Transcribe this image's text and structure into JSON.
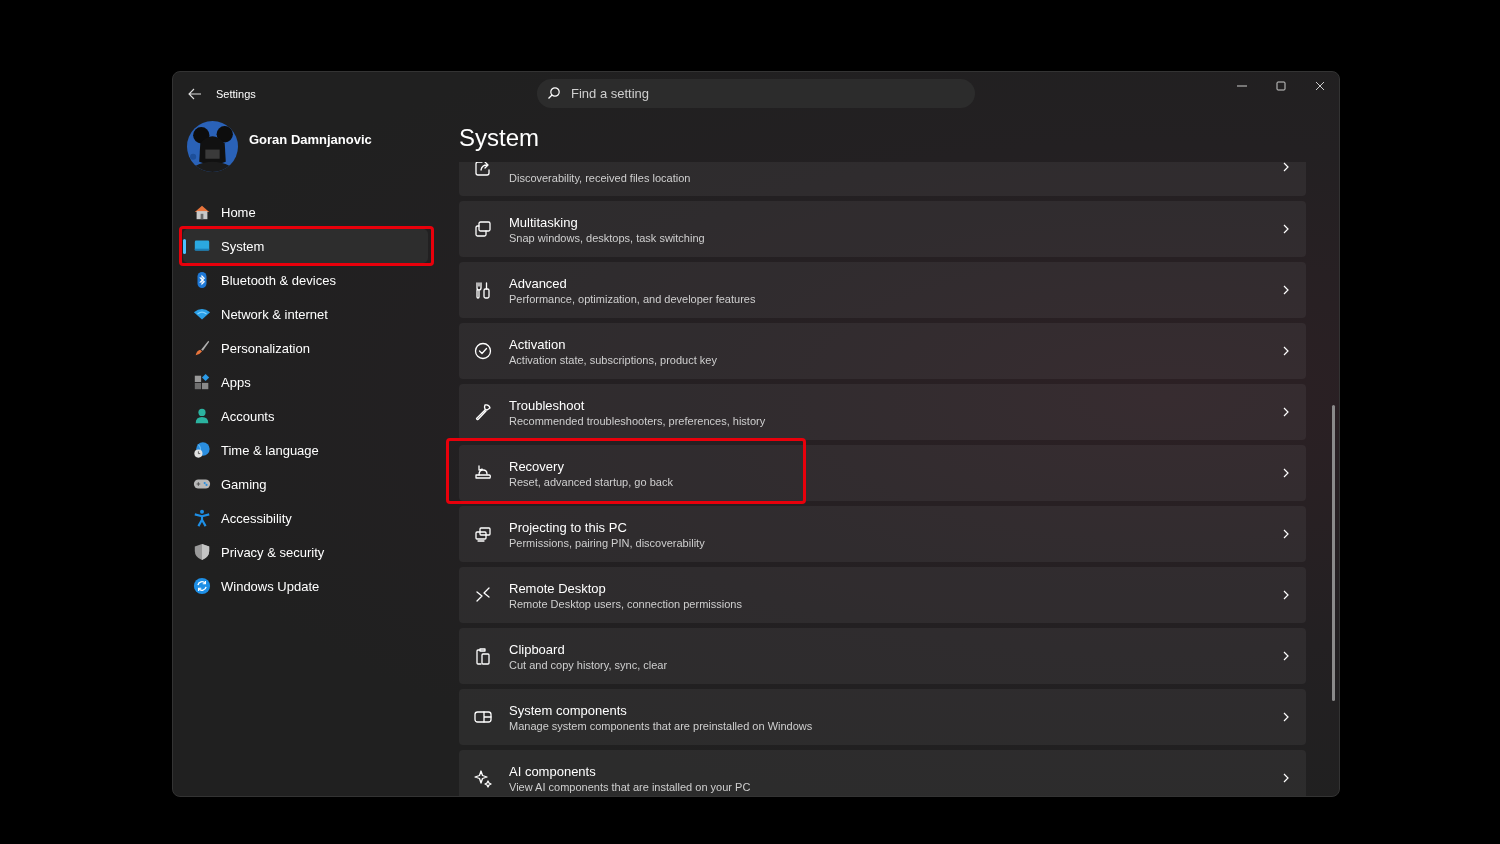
{
  "window": {
    "title": "Settings",
    "search": {
      "placeholder": "Find a setting"
    }
  },
  "user": {
    "name": "Goran Damnjanovic"
  },
  "sidebar": {
    "items": [
      {
        "label": "Home",
        "selected": false,
        "annotated": false
      },
      {
        "label": "System",
        "selected": true,
        "annotated": true
      },
      {
        "label": "Bluetooth & devices",
        "selected": false,
        "annotated": false
      },
      {
        "label": "Network & internet",
        "selected": false,
        "annotated": false
      },
      {
        "label": "Personalization",
        "selected": false,
        "annotated": false
      },
      {
        "label": "Apps",
        "selected": false,
        "annotated": false
      },
      {
        "label": "Accounts",
        "selected": false,
        "annotated": false
      },
      {
        "label": "Time & language",
        "selected": false,
        "annotated": false
      },
      {
        "label": "Gaming",
        "selected": false,
        "annotated": false
      },
      {
        "label": "Accessibility",
        "selected": false,
        "annotated": false
      },
      {
        "label": "Privacy & security",
        "selected": false,
        "annotated": false
      },
      {
        "label": "Windows Update",
        "selected": false,
        "annotated": false
      }
    ]
  },
  "page": {
    "title": "System",
    "settings": [
      {
        "description": "Discoverability, received files location",
        "annotated": false
      },
      {
        "title": "Multitasking",
        "description": "Snap windows, desktops, task switching",
        "annotated": false
      },
      {
        "title": "Advanced",
        "description": "Performance, optimization, and developer features",
        "annotated": false
      },
      {
        "title": "Activation",
        "description": "Activation state, subscriptions, product key",
        "annotated": false
      },
      {
        "title": "Troubleshoot",
        "description": "Recommended troubleshooters, preferences, history",
        "annotated": false
      },
      {
        "title": "Recovery",
        "description": "Reset, advanced startup, go back",
        "annotated": true
      },
      {
        "title": "Projecting to this PC",
        "description": "Permissions, pairing PIN, discoverability",
        "annotated": false
      },
      {
        "title": "Remote Desktop",
        "description": "Remote Desktop users, connection permissions",
        "annotated": false
      },
      {
        "title": "Clipboard",
        "description": "Cut and copy history, sync, clear",
        "annotated": false
      },
      {
        "title": "System components",
        "description": "Manage system components that are preinstalled on Windows",
        "annotated": false
      },
      {
        "title": "AI components",
        "description": "View AI components that are installed on your PC",
        "annotated": false
      }
    ]
  }
}
